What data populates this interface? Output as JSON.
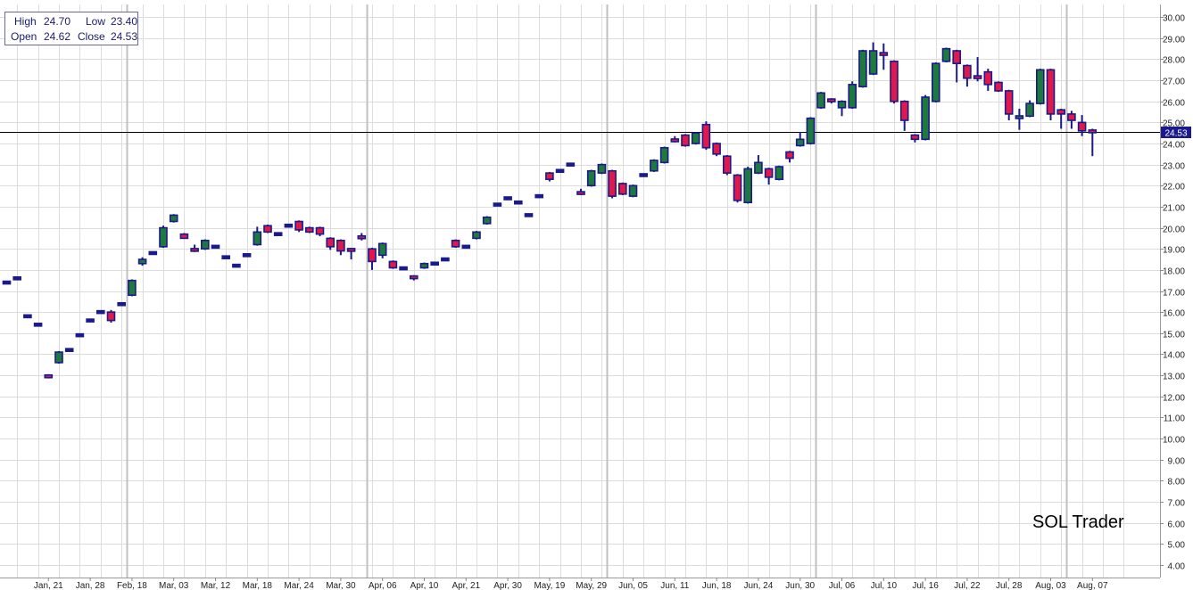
{
  "ohlc_box": {
    "high_label": "High",
    "high_value": "24.70",
    "low_label": "Low",
    "low_value": "23.40",
    "open_label": "Open",
    "open_value": "24.62",
    "close_label": "Close",
    "close_value": "24.53"
  },
  "watermark": "SOL Trader",
  "colors": {
    "up_fill": "#1e7a3c",
    "down_fill": "#e0194c",
    "outline": "#1a1a8c",
    "grid": "#dcdcdc",
    "grid_major": "#c0c0c0",
    "price_line": "#000000",
    "price_tag": "#1a1a8c"
  },
  "chart_data": {
    "type": "candlestick",
    "ylim": [
      3.4,
      30.6
    ],
    "y_ticks": [
      4,
      5,
      6,
      7,
      8,
      9,
      10,
      11,
      12,
      13,
      14,
      15,
      16,
      17,
      18,
      19,
      20,
      21,
      22,
      23,
      24,
      25,
      26,
      27,
      28,
      29,
      30
    ],
    "current_price": 24.53,
    "current_price_label": "24.53",
    "x_tick_labels": [
      {
        "label": "Jan, 21",
        "index": 4
      },
      {
        "label": "Jan, 28",
        "index": 8
      },
      {
        "label": "Feb, 18",
        "index": 12
      },
      {
        "label": "Mar, 03",
        "index": 16
      },
      {
        "label": "Mar, 12",
        "index": 20
      },
      {
        "label": "Mar, 18",
        "index": 24
      },
      {
        "label": "Mar, 24",
        "index": 28
      },
      {
        "label": "Mar, 30",
        "index": 32
      },
      {
        "label": "Apr, 06",
        "index": 36
      },
      {
        "label": "Apr, 10",
        "index": 40
      },
      {
        "label": "Apr, 21",
        "index": 44
      },
      {
        "label": "Apr, 30",
        "index": 48
      },
      {
        "label": "May, 19",
        "index": 52
      },
      {
        "label": "May, 29",
        "index": 56
      },
      {
        "label": "Jun, 05",
        "index": 60
      },
      {
        "label": "Jun, 11",
        "index": 64
      },
      {
        "label": "Jun, 18",
        "index": 68
      },
      {
        "label": "Jun, 24",
        "index": 72
      },
      {
        "label": "Jun, 30",
        "index": 76
      },
      {
        "label": "Jul, 06",
        "index": 80
      },
      {
        "label": "Jul, 10",
        "index": 84
      },
      {
        "label": "Jul, 16",
        "index": 88
      },
      {
        "label": "Jul, 22",
        "index": 92
      },
      {
        "label": "Jul, 28",
        "index": 96
      },
      {
        "label": "Aug, 03",
        "index": 100
      },
      {
        "label": "Aug, 07",
        "index": 104
      }
    ],
    "major_gridline_indices": [
      11.5,
      34.5,
      57.5,
      77.5,
      101.5
    ],
    "candles": [
      {
        "o": 17.4,
        "h": 17.45,
        "l": 17.35,
        "c": 17.4
      },
      {
        "o": 17.6,
        "h": 17.65,
        "l": 17.55,
        "c": 17.6
      },
      {
        "o": 15.8,
        "h": 15.85,
        "l": 15.75,
        "c": 15.8
      },
      {
        "o": 15.4,
        "h": 15.45,
        "l": 15.35,
        "c": 15.4
      },
      {
        "o": 13.0,
        "h": 13.05,
        "l": 12.85,
        "c": 12.9
      },
      {
        "o": 13.6,
        "h": 14.15,
        "l": 13.55,
        "c": 14.1
      },
      {
        "o": 14.2,
        "h": 14.25,
        "l": 14.15,
        "c": 14.2
      },
      {
        "o": 14.9,
        "h": 14.95,
        "l": 14.85,
        "c": 14.9
      },
      {
        "o": 15.6,
        "h": 15.65,
        "l": 15.55,
        "c": 15.6
      },
      {
        "o": 16.0,
        "h": 16.05,
        "l": 15.95,
        "c": 16.0
      },
      {
        "o": 16.0,
        "h": 16.1,
        "l": 15.5,
        "c": 15.6
      },
      {
        "o": 16.4,
        "h": 16.45,
        "l": 16.3,
        "c": 16.35
      },
      {
        "o": 16.8,
        "h": 17.55,
        "l": 16.75,
        "c": 17.5
      },
      {
        "o": 18.3,
        "h": 18.6,
        "l": 18.2,
        "c": 18.5
      },
      {
        "o": 18.8,
        "h": 18.85,
        "l": 18.75,
        "c": 18.8
      },
      {
        "o": 19.1,
        "h": 20.1,
        "l": 19.05,
        "c": 20.0
      },
      {
        "o": 20.3,
        "h": 20.65,
        "l": 20.25,
        "c": 20.6
      },
      {
        "o": 19.7,
        "h": 19.75,
        "l": 19.5,
        "c": 19.5
      },
      {
        "o": 19.0,
        "h": 19.2,
        "l": 18.85,
        "c": 18.9
      },
      {
        "o": 19.0,
        "h": 19.45,
        "l": 18.95,
        "c": 19.4
      },
      {
        "o": 19.1,
        "h": 19.15,
        "l": 19.05,
        "c": 19.1
      },
      {
        "o": 18.6,
        "h": 18.65,
        "l": 18.55,
        "c": 18.6
      },
      {
        "o": 18.2,
        "h": 18.25,
        "l": 18.15,
        "c": 18.2
      },
      {
        "o": 18.7,
        "h": 18.75,
        "l": 18.65,
        "c": 18.7
      },
      {
        "o": 19.2,
        "h": 20.05,
        "l": 19.15,
        "c": 19.8
      },
      {
        "o": 20.1,
        "h": 20.15,
        "l": 19.75,
        "c": 19.8
      },
      {
        "o": 19.7,
        "h": 19.75,
        "l": 19.65,
        "c": 19.7
      },
      {
        "o": 20.1,
        "h": 20.15,
        "l": 20.05,
        "c": 20.1
      },
      {
        "o": 20.3,
        "h": 20.35,
        "l": 19.8,
        "c": 19.9
      },
      {
        "o": 20.0,
        "h": 20.05,
        "l": 19.75,
        "c": 19.8
      },
      {
        "o": 20.0,
        "h": 20.05,
        "l": 19.6,
        "c": 19.7
      },
      {
        "o": 19.5,
        "h": 19.55,
        "l": 18.95,
        "c": 19.1
      },
      {
        "o": 19.4,
        "h": 19.45,
        "l": 18.7,
        "c": 18.9
      },
      {
        "o": 19.0,
        "h": 19.05,
        "l": 18.5,
        "c": 18.9
      },
      {
        "o": 19.6,
        "h": 19.75,
        "l": 19.4,
        "c": 19.5
      },
      {
        "o": 19.0,
        "h": 19.05,
        "l": 18.0,
        "c": 18.4
      },
      {
        "o": 18.7,
        "h": 19.3,
        "l": 18.55,
        "c": 19.25
      },
      {
        "o": 18.4,
        "h": 18.45,
        "l": 18.05,
        "c": 18.1
      },
      {
        "o": 18.1,
        "h": 18.15,
        "l": 18.0,
        "c": 18.05
      },
      {
        "o": 17.7,
        "h": 17.75,
        "l": 17.5,
        "c": 17.6
      },
      {
        "o": 18.1,
        "h": 18.35,
        "l": 18.05,
        "c": 18.3
      },
      {
        "o": 18.3,
        "h": 18.35,
        "l": 18.25,
        "c": 18.3
      },
      {
        "o": 18.5,
        "h": 18.55,
        "l": 18.45,
        "c": 18.5
      },
      {
        "o": 19.4,
        "h": 19.45,
        "l": 19.05,
        "c": 19.1
      },
      {
        "o": 19.1,
        "h": 19.15,
        "l": 19.05,
        "c": 19.1
      },
      {
        "o": 19.5,
        "h": 19.85,
        "l": 19.45,
        "c": 19.8
      },
      {
        "o": 20.2,
        "h": 20.55,
        "l": 20.15,
        "c": 20.5
      },
      {
        "o": 21.1,
        "h": 21.15,
        "l": 21.05,
        "c": 21.1
      },
      {
        "o": 21.4,
        "h": 21.45,
        "l": 21.35,
        "c": 21.4
      },
      {
        "o": 21.2,
        "h": 21.25,
        "l": 21.15,
        "c": 21.2
      },
      {
        "o": 20.6,
        "h": 20.65,
        "l": 20.55,
        "c": 20.6
      },
      {
        "o": 21.5,
        "h": 21.55,
        "l": 21.45,
        "c": 21.5
      },
      {
        "o": 22.6,
        "h": 22.65,
        "l": 22.2,
        "c": 22.3
      },
      {
        "o": 22.7,
        "h": 22.75,
        "l": 22.65,
        "c": 22.7
      },
      {
        "o": 23.0,
        "h": 23.05,
        "l": 22.95,
        "c": 23.0
      },
      {
        "o": 21.7,
        "h": 21.85,
        "l": 21.55,
        "c": 21.6
      },
      {
        "o": 22.0,
        "h": 22.75,
        "l": 21.95,
        "c": 22.7
      },
      {
        "o": 22.6,
        "h": 23.05,
        "l": 22.55,
        "c": 23.0
      },
      {
        "o": 22.7,
        "h": 22.75,
        "l": 21.4,
        "c": 21.5
      },
      {
        "o": 22.1,
        "h": 22.15,
        "l": 21.55,
        "c": 21.6
      },
      {
        "o": 21.5,
        "h": 22.05,
        "l": 21.45,
        "c": 22.0
      },
      {
        "o": 22.5,
        "h": 22.55,
        "l": 22.45,
        "c": 22.5
      },
      {
        "o": 22.7,
        "h": 23.25,
        "l": 22.65,
        "c": 23.2
      },
      {
        "o": 23.1,
        "h": 23.85,
        "l": 23.05,
        "c": 23.8
      },
      {
        "o": 24.2,
        "h": 24.35,
        "l": 24.05,
        "c": 24.1
      },
      {
        "o": 24.4,
        "h": 24.45,
        "l": 23.85,
        "c": 23.9
      },
      {
        "o": 24.0,
        "h": 24.55,
        "l": 23.95,
        "c": 24.5
      },
      {
        "o": 24.9,
        "h": 25.05,
        "l": 23.7,
        "c": 23.8
      },
      {
        "o": 24.0,
        "h": 24.05,
        "l": 23.4,
        "c": 23.5
      },
      {
        "o": 23.4,
        "h": 23.45,
        "l": 22.5,
        "c": 22.6
      },
      {
        "o": 22.5,
        "h": 22.55,
        "l": 21.2,
        "c": 21.3
      },
      {
        "o": 21.2,
        "h": 22.9,
        "l": 21.15,
        "c": 22.8
      },
      {
        "o": 22.6,
        "h": 23.45,
        "l": 22.55,
        "c": 23.1
      },
      {
        "o": 22.8,
        "h": 22.85,
        "l": 22.05,
        "c": 22.4
      },
      {
        "o": 22.3,
        "h": 22.95,
        "l": 22.25,
        "c": 22.9
      },
      {
        "o": 23.6,
        "h": 23.65,
        "l": 23.1,
        "c": 23.3
      },
      {
        "o": 23.9,
        "h": 24.55,
        "l": 23.85,
        "c": 24.2
      },
      {
        "o": 24.0,
        "h": 25.25,
        "l": 23.95,
        "c": 25.2
      },
      {
        "o": 25.7,
        "h": 26.45,
        "l": 25.65,
        "c": 26.4
      },
      {
        "o": 26.1,
        "h": 26.15,
        "l": 25.9,
        "c": 26.0
      },
      {
        "o": 25.7,
        "h": 26.05,
        "l": 25.3,
        "c": 26.0
      },
      {
        "o": 25.7,
        "h": 26.95,
        "l": 25.65,
        "c": 26.8
      },
      {
        "o": 26.7,
        "h": 28.45,
        "l": 26.65,
        "c": 28.4
      },
      {
        "o": 27.3,
        "h": 28.8,
        "l": 27.25,
        "c": 28.4
      },
      {
        "o": 28.3,
        "h": 28.75,
        "l": 27.5,
        "c": 28.2
      },
      {
        "o": 27.9,
        "h": 27.95,
        "l": 25.9,
        "c": 26.0
      },
      {
        "o": 26.0,
        "h": 26.05,
        "l": 24.6,
        "c": 25.1
      },
      {
        "o": 24.4,
        "h": 24.45,
        "l": 24.05,
        "c": 24.2
      },
      {
        "o": 24.2,
        "h": 26.3,
        "l": 24.15,
        "c": 26.2
      },
      {
        "o": 26.0,
        "h": 27.85,
        "l": 25.95,
        "c": 27.8
      },
      {
        "o": 27.9,
        "h": 28.55,
        "l": 27.85,
        "c": 28.5
      },
      {
        "o": 28.4,
        "h": 28.45,
        "l": 26.9,
        "c": 27.8
      },
      {
        "o": 27.7,
        "h": 27.75,
        "l": 26.7,
        "c": 27.1
      },
      {
        "o": 27.2,
        "h": 28.1,
        "l": 26.95,
        "c": 27.1
      },
      {
        "o": 27.4,
        "h": 27.55,
        "l": 26.5,
        "c": 26.8
      },
      {
        "o": 26.9,
        "h": 26.95,
        "l": 26.45,
        "c": 26.5
      },
      {
        "o": 26.5,
        "h": 26.55,
        "l": 25.1,
        "c": 25.4
      },
      {
        "o": 25.2,
        "h": 25.65,
        "l": 24.65,
        "c": 25.3
      },
      {
        "o": 25.3,
        "h": 26.05,
        "l": 25.25,
        "c": 25.9
      },
      {
        "o": 25.9,
        "h": 27.55,
        "l": 25.85,
        "c": 27.5
      },
      {
        "o": 27.5,
        "h": 27.55,
        "l": 25.1,
        "c": 25.4
      },
      {
        "o": 25.6,
        "h": 25.65,
        "l": 24.7,
        "c": 25.4
      },
      {
        "o": 25.4,
        "h": 25.55,
        "l": 24.7,
        "c": 25.1
      },
      {
        "o": 25.0,
        "h": 25.35,
        "l": 24.35,
        "c": 24.6
      },
      {
        "o": 24.62,
        "h": 24.7,
        "l": 23.4,
        "c": 24.53
      }
    ]
  }
}
